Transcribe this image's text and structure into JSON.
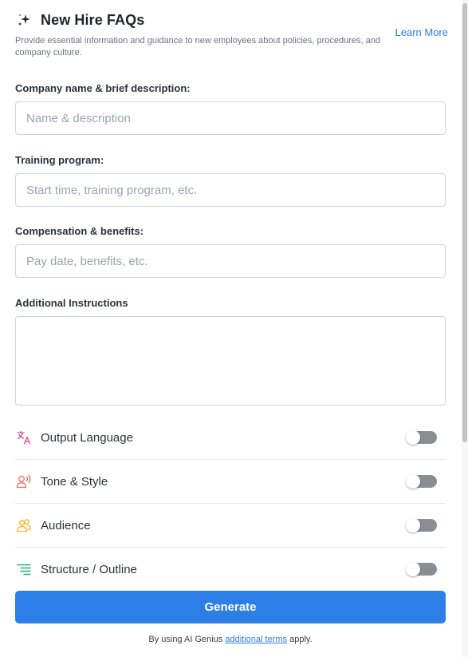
{
  "header": {
    "title": "New Hire FAQs",
    "subtitle": "Provide essential information and guidance to new employees about policies, procedures, and company culture.",
    "learn_more": "Learn More",
    "icon": "sparkle-icon"
  },
  "fields": [
    {
      "label": "Company name & brief description:",
      "placeholder": "Name & description",
      "value": ""
    },
    {
      "label": "Training program:",
      "placeholder": "Start time, training program, etc.",
      "value": ""
    },
    {
      "label": "Compensation & benefits:",
      "placeholder": "Pay date, benefits, etc.",
      "value": ""
    }
  ],
  "additional": {
    "label": "Additional Instructions",
    "value": ""
  },
  "options": [
    {
      "label": "Output Language",
      "icon": "translate-icon",
      "color": "#e0459a",
      "enabled": false
    },
    {
      "label": "Tone & Style",
      "icon": "speaker-icon",
      "color": "#f0685a",
      "enabled": false
    },
    {
      "label": "Audience",
      "icon": "people-icon",
      "color": "#f2b31f",
      "enabled": false
    },
    {
      "label": "Structure / Outline",
      "icon": "list-icon",
      "color": "#22b573",
      "enabled": false
    }
  ],
  "generate_label": "Generate",
  "footer": {
    "prefix": "By using AI Genius",
    "link": "additional terms",
    "suffix": "apply."
  },
  "colors": {
    "accent": "#2d7fe8",
    "link": "#2b7de9",
    "toggle_off": "#8a8d91"
  }
}
